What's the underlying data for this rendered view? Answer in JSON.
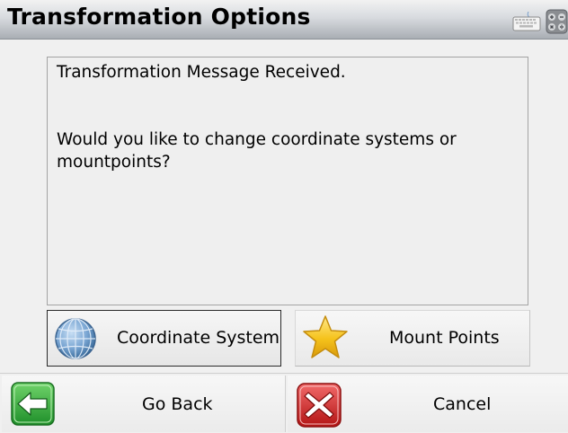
{
  "window": {
    "title": "Transformation Options",
    "toolbar_icons": [
      "keyboard-icon",
      "calculator-icon"
    ]
  },
  "message": {
    "line1": "Transformation Message Received.",
    "line2": "Would you like to change coordinate systems or",
    "line3": "mountpoints?"
  },
  "options": {
    "coordinate_system_label": "Coordinate System",
    "coordinate_system_icon": "globe-icon",
    "mount_points_label": "Mount Points",
    "mount_points_icon": "star-icon"
  },
  "footer": {
    "go_back_label": "Go Back",
    "go_back_icon": "green-back-arrow-icon",
    "cancel_label": "Cancel",
    "cancel_icon": "red-x-icon"
  },
  "colors": {
    "title_gradient_top": "#f2f2f2",
    "title_gradient_bottom": "#a9aeb4",
    "back_green": "#2fa83a",
    "cancel_red": "#d22a2a",
    "star_gold": "#f3c21b",
    "globe_blue": "#5f8fc0"
  }
}
